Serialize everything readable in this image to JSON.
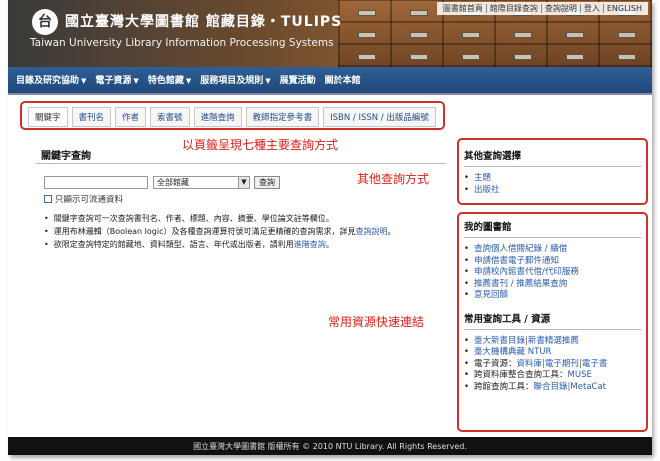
{
  "header": {
    "logo_glyph": "台",
    "title_zh": "國立臺灣大學圖書館  館藏目錄・TULIPS",
    "title_en": "Taiwan University Library Information Processing Systems",
    "top_links": [
      "圖書館首頁",
      "館際目錄查詢",
      "查詢說明",
      "登入",
      "ENGLISH"
    ]
  },
  "nav": {
    "items": [
      {
        "label": "目錄及研究協助",
        "caret": "▼"
      },
      {
        "label": "電子資源",
        "caret": "▼"
      },
      {
        "label": "特色館藏",
        "caret": "▼"
      },
      {
        "label": "服務項目及規則",
        "caret": "▼"
      },
      {
        "label": "展覽活動",
        "caret": ""
      },
      {
        "label": "關於本館",
        "caret": ""
      }
    ]
  },
  "tabs": [
    "關鍵字",
    "書刊名",
    "作者",
    "索書號",
    "進階查詢",
    "教師指定參考書",
    "ISBN / ISSN / 出版品編號"
  ],
  "callouts": {
    "tabs": "以頁籤呈現七種主要查詢方式",
    "other": "其他查詢方式",
    "links": "常用資源快速連結"
  },
  "search": {
    "title": "關鍵字查詢",
    "keyword_value": "",
    "library_selected": "全部館藏",
    "query_button": "查詢",
    "checkbox_label": "只顯示可流通資料",
    "notes": [
      {
        "text": "關鍵字查詢可一次查詢書刊名、作者、標題、內容、摘要、學位論文註等欄位。",
        "link": "",
        "tail": ""
      },
      {
        "text": "運用布林邏輯（Boolean logic）及各種查詢運算符號可滿足更精確的查詢需求，詳見",
        "link": "查詢說明",
        "tail": "。"
      },
      {
        "text": "欲限定查詢特定的館藏地、資料類型、語言、年代或出版者，請利用",
        "link": "進階查詢",
        "tail": "。"
      }
    ]
  },
  "sidebar": {
    "other_title": "其他查詢選擇",
    "other_links": [
      "主題",
      "出版社"
    ],
    "mylib_title": "我的圖書館",
    "mylib_links": [
      "查詢個人借閱紀錄 / 續借",
      "申請借書電子郵件通知",
      "申請校內館書代借/代印服務",
      "推薦書刊 / 推薦結果查詢",
      "意見回饋"
    ],
    "tools_title": "常用查詢工具 / 資源",
    "tools": [
      {
        "prefix": "",
        "links": [
          "臺大新書目錄",
          "新書精選推薦"
        ]
      },
      {
        "prefix": "",
        "links": [
          "臺大機構典藏 NTUR"
        ]
      },
      {
        "prefix": "電子資源：",
        "links": [
          "資料庫",
          "電子期刊",
          "電子書"
        ]
      },
      {
        "prefix": "跨資料庫整合查詢工具：",
        "links": [
          "MUSE"
        ]
      },
      {
        "prefix": "跨館查詢工具：",
        "links": [
          "聯合目錄",
          "MetaCat"
        ]
      }
    ]
  },
  "footer": {
    "text": "國立臺灣大學圖書館 版權所有 © 2010 NTU Library. All Rights Reserved."
  },
  "colors": {
    "nav_bg": "#1e4878",
    "callout_red": "#e0201a",
    "link_blue": "#2a5db0"
  }
}
